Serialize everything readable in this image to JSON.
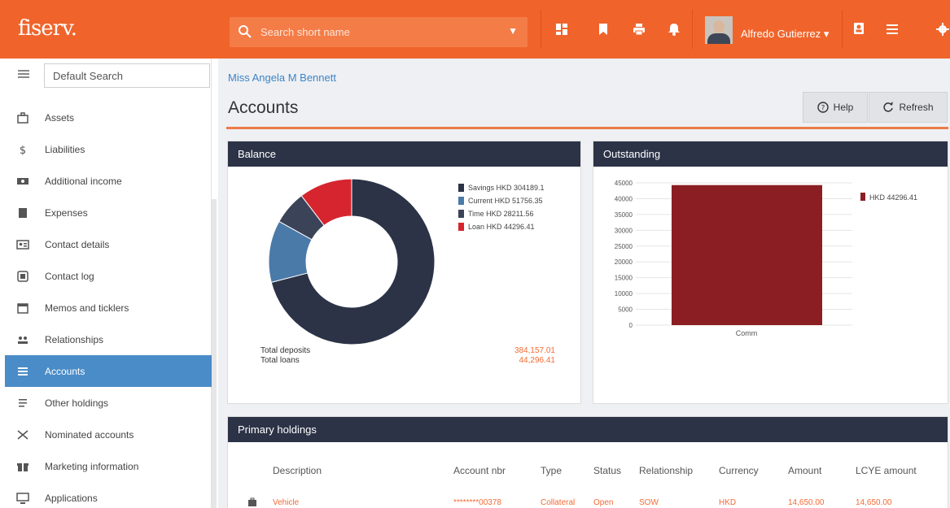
{
  "app": {
    "logo": "fiserv."
  },
  "topbar": {
    "search_placeholder": "Search short name",
    "user_name": "Alfredo Gutierrez"
  },
  "sidebar": {
    "search_value": "Default Search",
    "items": [
      {
        "label": "Assets",
        "icon": "briefcase-icon"
      },
      {
        "label": "Liabilities",
        "icon": "dollar-icon"
      },
      {
        "label": "Additional income",
        "icon": "cash-icon"
      },
      {
        "label": "Expenses",
        "icon": "receipt-icon"
      },
      {
        "label": "Contact details",
        "icon": "id-card-icon"
      },
      {
        "label": "Contact log",
        "icon": "log-icon"
      },
      {
        "label": "Memos and ticklers",
        "icon": "calendar-icon"
      },
      {
        "label": "Relationships",
        "icon": "people-icon"
      },
      {
        "label": "Accounts",
        "icon": "list-icon",
        "active": true
      },
      {
        "label": "Other holdings",
        "icon": "lines-icon"
      },
      {
        "label": "Nominated accounts",
        "icon": "arrows-icon"
      },
      {
        "label": "Marketing information",
        "icon": "gift-icon"
      },
      {
        "label": "Applications",
        "icon": "monitor-icon"
      }
    ]
  },
  "main": {
    "breadcrumb": "Miss Angela M Bennett",
    "title": "Accounts",
    "help_label": "Help",
    "refresh_label": "Refresh"
  },
  "balance": {
    "title": "Balance",
    "total_deposits_label": "Total deposits",
    "total_deposits_value": "384,157.01",
    "total_loans_label": "Total loans",
    "total_loans_value": "44,296.41"
  },
  "outstanding": {
    "title": "Outstanding"
  },
  "primary_holdings": {
    "title": "Primary holdings",
    "columns": [
      "Description",
      "Account nbr",
      "Type",
      "Status",
      "Relationship",
      "Currency",
      "Amount",
      "LCYE amount"
    ],
    "rows": [
      [
        "Vehicle",
        "********00378",
        "Collateral",
        "Open",
        "SOW",
        "HKD",
        "14,650.00",
        "14,650.00"
      ]
    ]
  },
  "colors": {
    "brand": "#f0642b",
    "savings": "#2c3347",
    "current": "#4a7aa8",
    "time": "#3a4358",
    "loan": "#d6252f",
    "bar": "#8b1e22"
  },
  "chart_data": [
    {
      "type": "pie",
      "title": "Balance",
      "categories": [
        "Savings",
        "Current",
        "Time",
        "Loan"
      ],
      "values": [
        304189.1,
        51756.35,
        28211.56,
        44296.41
      ],
      "legend": [
        "Savings HKD 304189.1",
        "Current HKD 51756.35",
        "Time HKD 28211.56",
        "Loan HKD 44296.41"
      ],
      "legend_position": "right"
    },
    {
      "type": "bar",
      "title": "Outstanding",
      "categories": [
        "Comm"
      ],
      "series": [
        {
          "name": "HKD 44296.41",
          "values": [
            44296.41
          ]
        }
      ],
      "ylim": [
        0,
        45000
      ],
      "yticks": [
        "45000",
        "40000",
        "35000",
        "30000",
        "25000",
        "20000",
        "15000",
        "10000",
        "5000",
        "0"
      ],
      "legend_position": "right"
    }
  ]
}
